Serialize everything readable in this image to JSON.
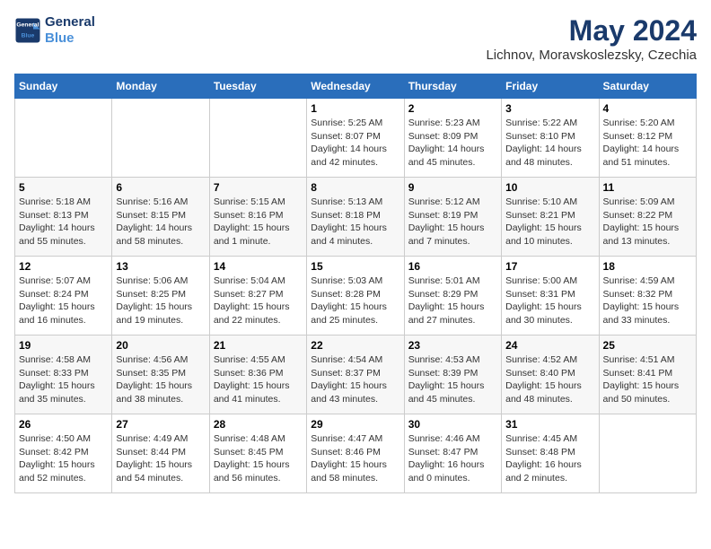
{
  "header": {
    "logo_line1": "General",
    "logo_line2": "Blue",
    "month": "May 2024",
    "location": "Lichnov, Moravskoslezsky, Czechia"
  },
  "weekdays": [
    "Sunday",
    "Monday",
    "Tuesday",
    "Wednesday",
    "Thursday",
    "Friday",
    "Saturday"
  ],
  "weeks": [
    [
      {
        "day": "",
        "info": ""
      },
      {
        "day": "",
        "info": ""
      },
      {
        "day": "",
        "info": ""
      },
      {
        "day": "1",
        "info": "Sunrise: 5:25 AM\nSunset: 8:07 PM\nDaylight: 14 hours\nand 42 minutes."
      },
      {
        "day": "2",
        "info": "Sunrise: 5:23 AM\nSunset: 8:09 PM\nDaylight: 14 hours\nand 45 minutes."
      },
      {
        "day": "3",
        "info": "Sunrise: 5:22 AM\nSunset: 8:10 PM\nDaylight: 14 hours\nand 48 minutes."
      },
      {
        "day": "4",
        "info": "Sunrise: 5:20 AM\nSunset: 8:12 PM\nDaylight: 14 hours\nand 51 minutes."
      }
    ],
    [
      {
        "day": "5",
        "info": "Sunrise: 5:18 AM\nSunset: 8:13 PM\nDaylight: 14 hours\nand 55 minutes."
      },
      {
        "day": "6",
        "info": "Sunrise: 5:16 AM\nSunset: 8:15 PM\nDaylight: 14 hours\nand 58 minutes."
      },
      {
        "day": "7",
        "info": "Sunrise: 5:15 AM\nSunset: 8:16 PM\nDaylight: 15 hours\nand 1 minute."
      },
      {
        "day": "8",
        "info": "Sunrise: 5:13 AM\nSunset: 8:18 PM\nDaylight: 15 hours\nand 4 minutes."
      },
      {
        "day": "9",
        "info": "Sunrise: 5:12 AM\nSunset: 8:19 PM\nDaylight: 15 hours\nand 7 minutes."
      },
      {
        "day": "10",
        "info": "Sunrise: 5:10 AM\nSunset: 8:21 PM\nDaylight: 15 hours\nand 10 minutes."
      },
      {
        "day": "11",
        "info": "Sunrise: 5:09 AM\nSunset: 8:22 PM\nDaylight: 15 hours\nand 13 minutes."
      }
    ],
    [
      {
        "day": "12",
        "info": "Sunrise: 5:07 AM\nSunset: 8:24 PM\nDaylight: 15 hours\nand 16 minutes."
      },
      {
        "day": "13",
        "info": "Sunrise: 5:06 AM\nSunset: 8:25 PM\nDaylight: 15 hours\nand 19 minutes."
      },
      {
        "day": "14",
        "info": "Sunrise: 5:04 AM\nSunset: 8:27 PM\nDaylight: 15 hours\nand 22 minutes."
      },
      {
        "day": "15",
        "info": "Sunrise: 5:03 AM\nSunset: 8:28 PM\nDaylight: 15 hours\nand 25 minutes."
      },
      {
        "day": "16",
        "info": "Sunrise: 5:01 AM\nSunset: 8:29 PM\nDaylight: 15 hours\nand 27 minutes."
      },
      {
        "day": "17",
        "info": "Sunrise: 5:00 AM\nSunset: 8:31 PM\nDaylight: 15 hours\nand 30 minutes."
      },
      {
        "day": "18",
        "info": "Sunrise: 4:59 AM\nSunset: 8:32 PM\nDaylight: 15 hours\nand 33 minutes."
      }
    ],
    [
      {
        "day": "19",
        "info": "Sunrise: 4:58 AM\nSunset: 8:33 PM\nDaylight: 15 hours\nand 35 minutes."
      },
      {
        "day": "20",
        "info": "Sunrise: 4:56 AM\nSunset: 8:35 PM\nDaylight: 15 hours\nand 38 minutes."
      },
      {
        "day": "21",
        "info": "Sunrise: 4:55 AM\nSunset: 8:36 PM\nDaylight: 15 hours\nand 41 minutes."
      },
      {
        "day": "22",
        "info": "Sunrise: 4:54 AM\nSunset: 8:37 PM\nDaylight: 15 hours\nand 43 minutes."
      },
      {
        "day": "23",
        "info": "Sunrise: 4:53 AM\nSunset: 8:39 PM\nDaylight: 15 hours\nand 45 minutes."
      },
      {
        "day": "24",
        "info": "Sunrise: 4:52 AM\nSunset: 8:40 PM\nDaylight: 15 hours\nand 48 minutes."
      },
      {
        "day": "25",
        "info": "Sunrise: 4:51 AM\nSunset: 8:41 PM\nDaylight: 15 hours\nand 50 minutes."
      }
    ],
    [
      {
        "day": "26",
        "info": "Sunrise: 4:50 AM\nSunset: 8:42 PM\nDaylight: 15 hours\nand 52 minutes."
      },
      {
        "day": "27",
        "info": "Sunrise: 4:49 AM\nSunset: 8:44 PM\nDaylight: 15 hours\nand 54 minutes."
      },
      {
        "day": "28",
        "info": "Sunrise: 4:48 AM\nSunset: 8:45 PM\nDaylight: 15 hours\nand 56 minutes."
      },
      {
        "day": "29",
        "info": "Sunrise: 4:47 AM\nSunset: 8:46 PM\nDaylight: 15 hours\nand 58 minutes."
      },
      {
        "day": "30",
        "info": "Sunrise: 4:46 AM\nSunset: 8:47 PM\nDaylight: 16 hours\nand 0 minutes."
      },
      {
        "day": "31",
        "info": "Sunrise: 4:45 AM\nSunset: 8:48 PM\nDaylight: 16 hours\nand 2 minutes."
      },
      {
        "day": "",
        "info": ""
      }
    ]
  ]
}
